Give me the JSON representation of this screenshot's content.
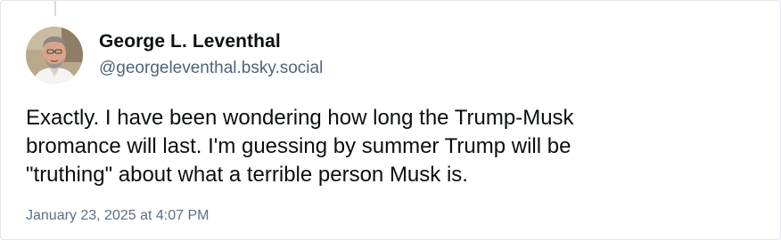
{
  "author": {
    "display_name": "George L. Leventhal",
    "handle": "@georgeleventhal.bsky.social",
    "avatar_icon": "avatar-photo-icon"
  },
  "post": {
    "lines": [
      "Exactly. I have been wondering how long the Trump-Musk",
      "bromance will last. I'm guessing by summer Trump will be",
      "\"truthing\" about what a terrible person Musk is."
    ],
    "timestamp": "January 23, 2025 at 4:07 PM"
  },
  "colors": {
    "name": "#0b0f14",
    "handle": "#4f6478",
    "timestamp": "#5b7086",
    "border": "#e3e8ee"
  }
}
